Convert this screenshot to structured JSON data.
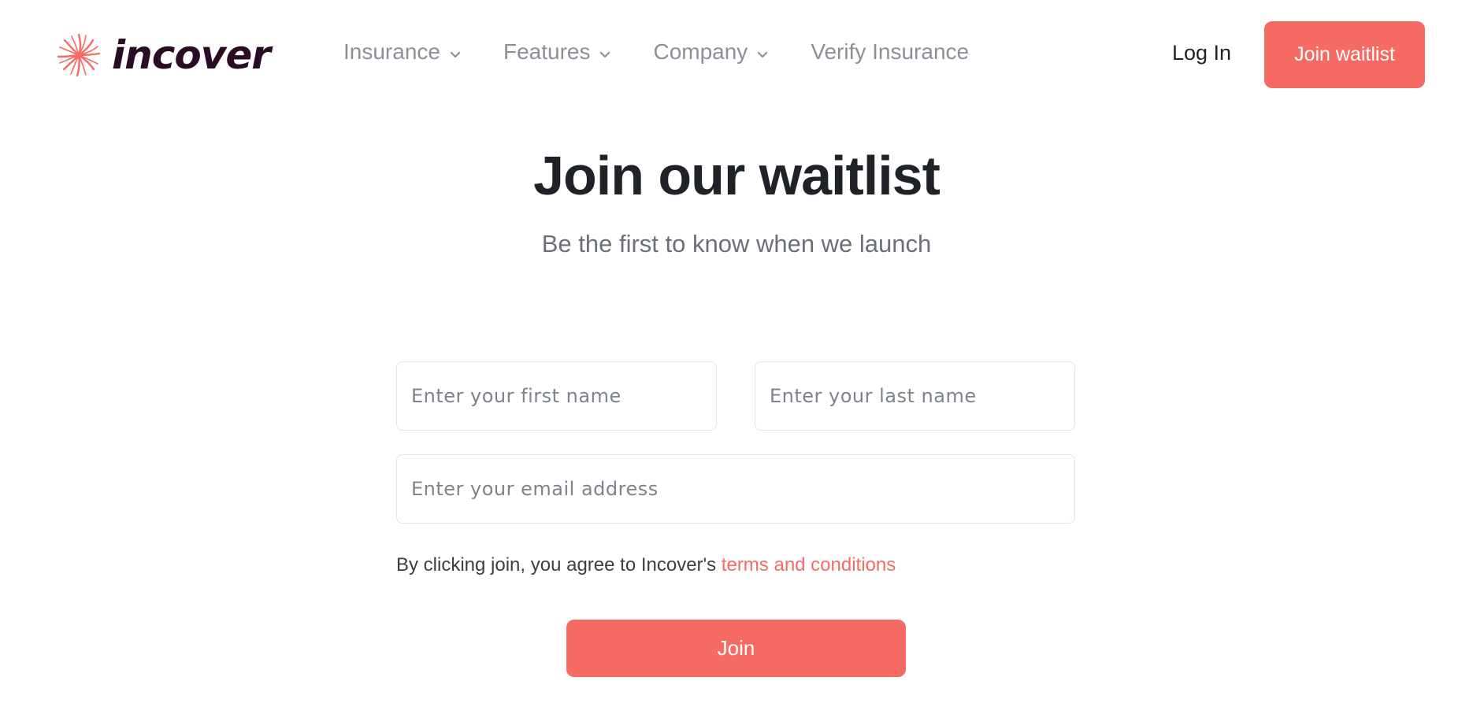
{
  "brand": {
    "name": "incover",
    "accent_color": "#f56b63",
    "logo_text_color": "#2a0c24"
  },
  "nav": {
    "items": [
      {
        "label": "Insurance",
        "has_dropdown": true
      },
      {
        "label": "Features",
        "has_dropdown": true
      },
      {
        "label": "Company",
        "has_dropdown": true
      },
      {
        "label": "Verify Insurance",
        "has_dropdown": false
      }
    ],
    "login_label": "Log In",
    "cta_label": "Join waitlist"
  },
  "hero": {
    "title": "Join our waitlist",
    "subtitle": "Be the first to know when we launch"
  },
  "form": {
    "first_name": {
      "placeholder": "Enter your first name",
      "value": ""
    },
    "last_name": {
      "placeholder": "Enter your last name",
      "value": ""
    },
    "email": {
      "placeholder": "Enter your email address",
      "value": ""
    },
    "terms_prefix": "By clicking join, you agree to Incover's",
    "terms_link": "terms and conditions",
    "submit_label": "Join"
  },
  "icons": {
    "logo": "starburst-icon",
    "dropdown": "chevron-down-icon"
  }
}
